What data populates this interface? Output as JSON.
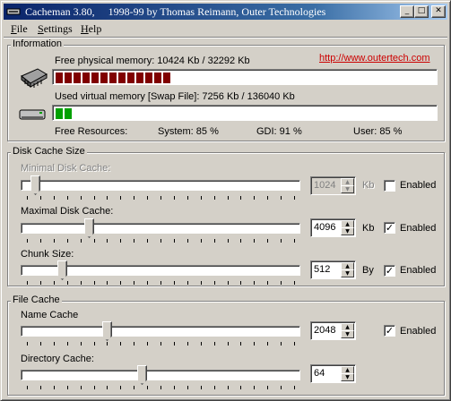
{
  "window": {
    "title": "Cacheman 3.80,     1998-99 by Thomas Reimann, Outer Technologies",
    "minimize_glyph": "_",
    "maximize_glyph": "□",
    "close_glyph": "✕"
  },
  "menu": [
    "File",
    "Settings",
    "Help"
  ],
  "information": {
    "title": "Information",
    "physical_label": "Free physical memory: 10424 Kb / 32292 Kb",
    "physical_fraction": 0.32,
    "physical_color": "#800000",
    "virtual_label": "Used virtual memory [Swap File]: 7256 Kb / 136040 Kb",
    "virtual_fraction": 0.05,
    "virtual_color": "#00a000",
    "link": "http://www.outertech.com",
    "free_resources_label": "Free Resources:",
    "system": "System: 85 %",
    "gdi": "GDI: 91 %",
    "user": "User: 85 %"
  },
  "disk_cache": {
    "title": "Disk Cache Size",
    "min": {
      "label": "Minimal Disk Cache:",
      "value": "1024",
      "unit": "Kb",
      "enabled_label": "Enabled",
      "checked": false,
      "disabled": true
    },
    "max": {
      "label": "Maximal Disk Cache:",
      "value": "4096",
      "unit": "Kb",
      "enabled_label": "Enabled",
      "checked": true,
      "disabled": false
    },
    "chunk": {
      "label": "Chunk Size:",
      "value": "512",
      "unit": "By",
      "enabled_label": "Enabled",
      "checked": true,
      "disabled": false
    }
  },
  "file_cache": {
    "title": "File Cache",
    "name": {
      "label": "Name Cache",
      "value": "2048",
      "enabled_label": "Enabled",
      "checked": true
    },
    "directory": {
      "label": "Directory Cache:",
      "value": "64"
    }
  },
  "slider_levels": {
    "min_cache": 0.03,
    "max_cache": 0.23,
    "chunk": 0.13,
    "name_cache": 0.3,
    "directory_cache": 0.43
  }
}
